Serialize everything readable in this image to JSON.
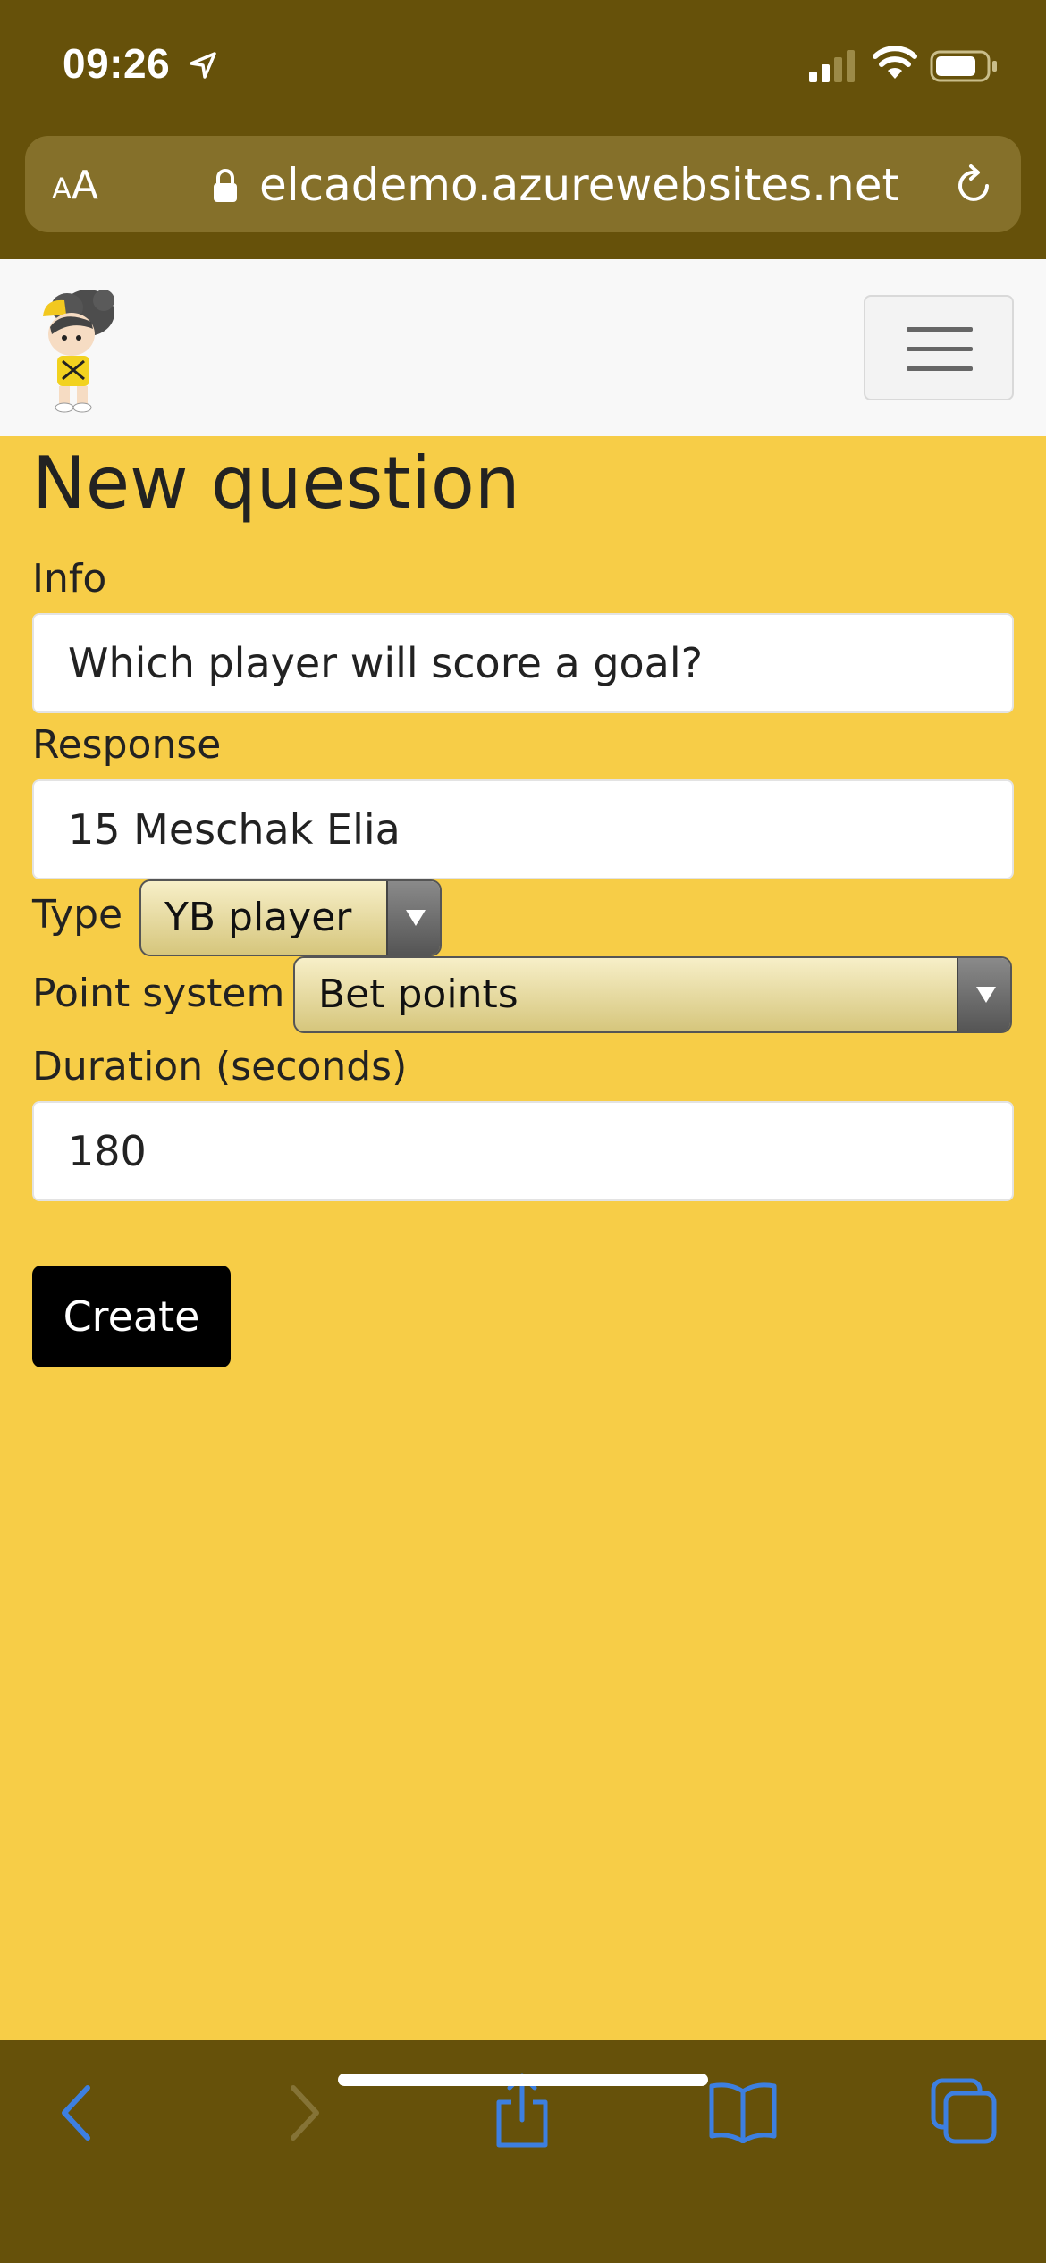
{
  "status_bar": {
    "time": "09:26"
  },
  "browser": {
    "reader_label_small": "A",
    "reader_label_large": "A",
    "url": "elcademo.azurewebsites.net"
  },
  "form": {
    "title": "New question",
    "info_label": "Info",
    "info_value": "Which player will score a goal?",
    "response_label": "Response",
    "response_value": "15 Meschak Elia",
    "type_label": "Type",
    "type_value": "YB player",
    "point_system_label": "Point system",
    "point_system_value": "Bet points",
    "duration_label": "Duration (seconds)",
    "duration_value": "180",
    "create_label": "Create"
  },
  "colors": {
    "page_background": "#f7cd47",
    "browser_chrome": "#66510a",
    "toolbar_icon_active": "#3d7fe0",
    "toolbar_icon_disabled": "#857336"
  }
}
